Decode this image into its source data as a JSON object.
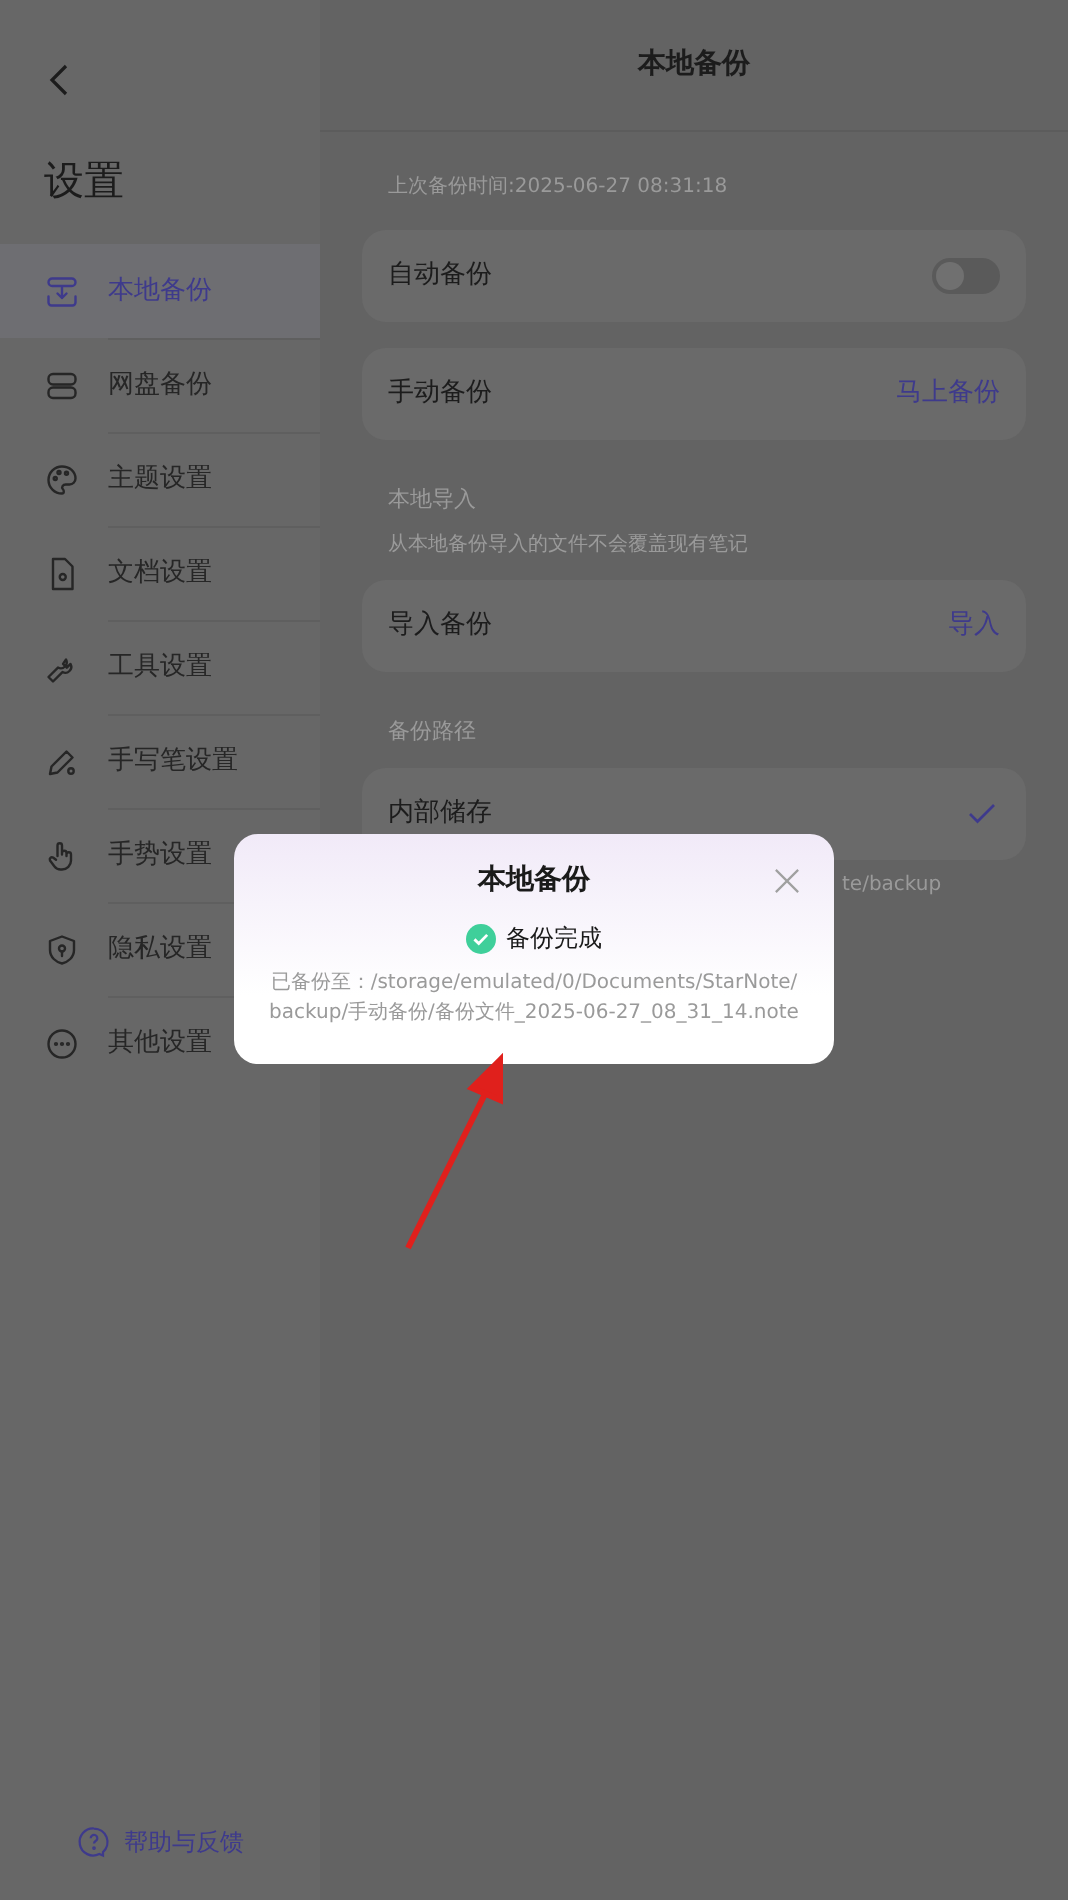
{
  "sidebar": {
    "title": "设置",
    "items": [
      {
        "label": "本地备份",
        "selected": true
      },
      {
        "label": "网盘备份",
        "selected": false
      },
      {
        "label": "主题设置",
        "selected": false
      },
      {
        "label": "文档设置",
        "selected": false
      },
      {
        "label": "工具设置",
        "selected": false
      },
      {
        "label": "手写笔设置",
        "selected": false
      },
      {
        "label": "手势设置",
        "selected": false
      },
      {
        "label": "隐私设置",
        "selected": false
      },
      {
        "label": "其他设置",
        "selected": false
      }
    ],
    "help": "帮助与反馈"
  },
  "header": {
    "title": "本地备份"
  },
  "last_backup": "上次备份时间:2025-06-27 08:31:18",
  "sections": [
    {
      "rows": [
        {
          "kind": "toggle",
          "label": "自动备份",
          "on": false
        },
        {
          "kind": "action",
          "label": "手动备份",
          "action": "马上备份"
        }
      ]
    },
    {
      "title": "本地导入",
      "hint": "从本地备份导入的文件不会覆盖现有笔记",
      "rows": [
        {
          "kind": "action",
          "label": "导入备份",
          "action": "导入"
        }
      ]
    },
    {
      "title": "备份路径",
      "rows": [
        {
          "kind": "check",
          "label": "内部储存",
          "checked": true
        }
      ],
      "hint_visible": "te/backup"
    }
  ],
  "dialog": {
    "title": "本地备份",
    "status": "备份完成",
    "message": "已备份至：/storage/emulated/0/Documents/StarNote/backup/手动备份/备份文件_2025-06-27_08_31_14.note"
  }
}
